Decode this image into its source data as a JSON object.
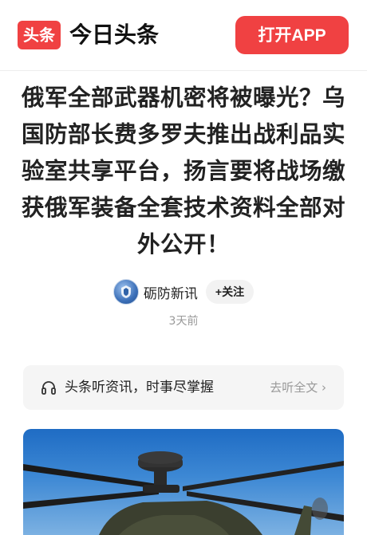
{
  "header": {
    "logo_text": "头条",
    "app_name": "今日头条",
    "open_app_label": "打开APP"
  },
  "article": {
    "title": "俄军全部武器机密将被曝光？乌国防部长费多罗夫推出战利品实验室共享平台，扬言要将战场缴获俄军装备全套技术资料全部对外公开！",
    "author": "砺防新讯",
    "follow_label": "+关注",
    "time": "3天前"
  },
  "listen_bar": {
    "icon": "headphone-icon",
    "text": "头条听资讯，时事尽掌握",
    "action": "去听全文 ›"
  },
  "image": {
    "subject": "helicopter"
  },
  "colors": {
    "brand_red": "#f04142",
    "text_primary": "#222222",
    "text_secondary": "#999999",
    "panel_bg": "#f5f5f5"
  }
}
